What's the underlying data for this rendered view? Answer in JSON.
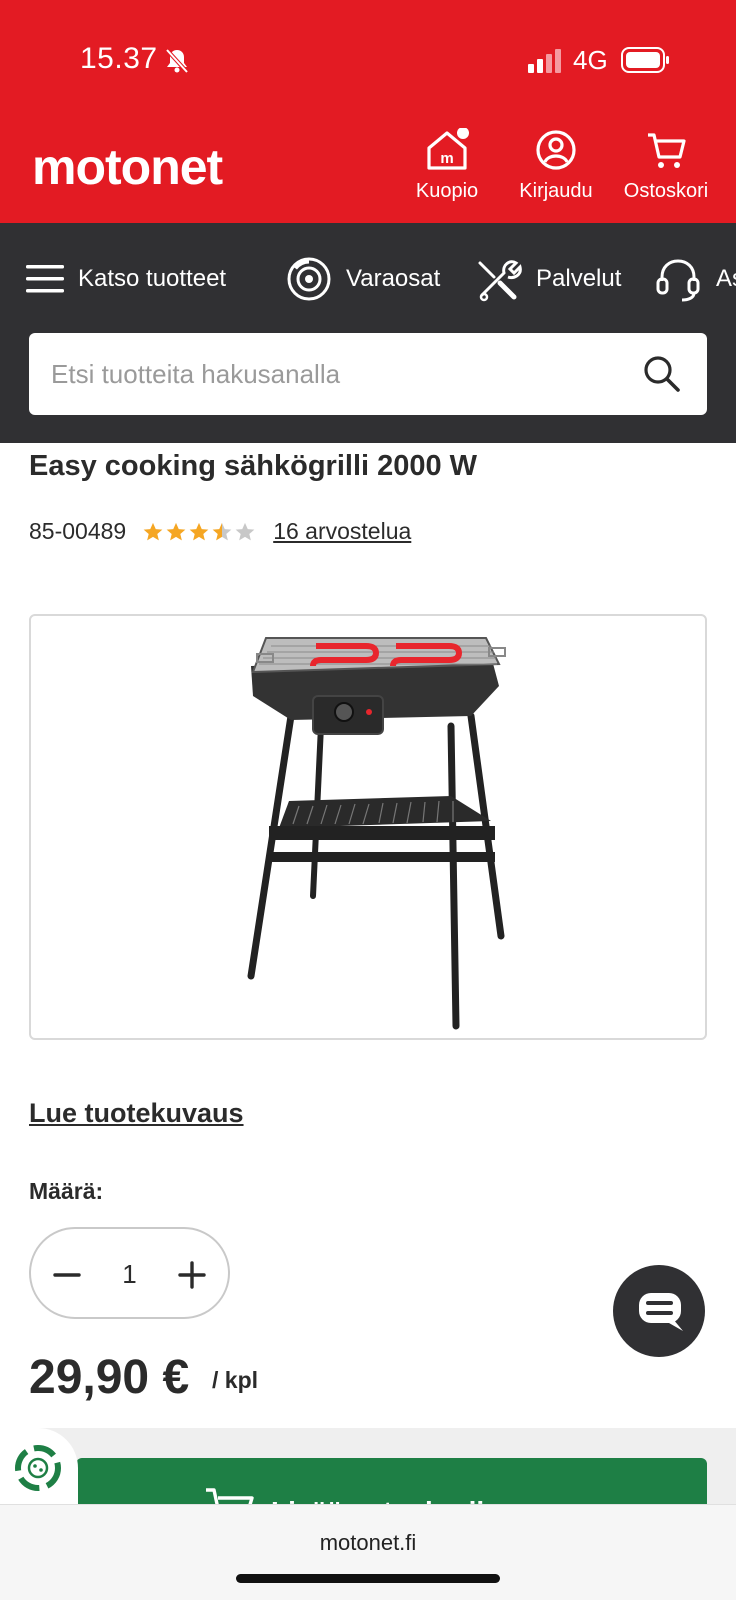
{
  "status_bar": {
    "time": "15.37",
    "network": "4G"
  },
  "header": {
    "logo": "motonet",
    "store_label": "Kuopio",
    "login_label": "Kirjaudu",
    "cart_label": "Ostoskori",
    "brand_color": "#e31b23"
  },
  "nav": {
    "items": [
      {
        "label": "Katso tuotteet",
        "icon": "hamburger-menu-icon"
      },
      {
        "label": "Varaosat",
        "icon": "brake-disc-icon"
      },
      {
        "label": "Palvelut",
        "icon": "tools-icon"
      },
      {
        "label": "As",
        "icon": "headset-icon"
      }
    ]
  },
  "search": {
    "placeholder": "Etsi tuotteita hakusanalla"
  },
  "product": {
    "title": "Easy cooking sähkögrilli 2000 W",
    "sku": "85-00489",
    "rating": 3.5,
    "rating_max": 5,
    "reviews_label": "16 arvostelua",
    "read_description": "Lue tuotekuvaus",
    "quantity_label": "Määrä:",
    "quantity": "1",
    "price": "29,90 €",
    "price_unit": "/ kpl",
    "add_to_cart_label": "Lisää ostoskoriin"
  },
  "browser": {
    "url": "motonet.fi"
  },
  "colors": {
    "accent_green": "#1e7f45",
    "dark_nav": "#303033",
    "star": "#f5a623"
  }
}
